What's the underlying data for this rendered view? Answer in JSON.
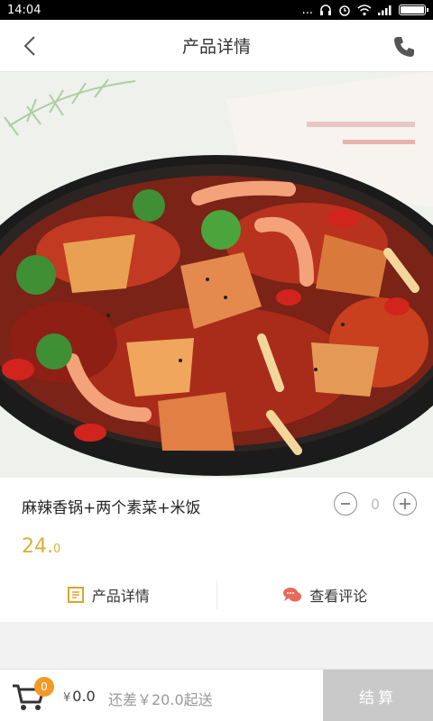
{
  "status_bar": {
    "time": "14:04",
    "dots": "..."
  },
  "header": {
    "title": "产品详情"
  },
  "product": {
    "name": "麻辣香锅+两个素菜+米饭",
    "price_int": "24.",
    "price_dec": "0",
    "quantity": "0"
  },
  "tabs": [
    {
      "label": "产品详情",
      "icon": "document-icon"
    },
    {
      "label": "查看评论",
      "icon": "comment-icon"
    }
  ],
  "cart": {
    "badge": "0",
    "currency": "¥",
    "total": "0.0",
    "min_order_text": "还差￥20.0起送",
    "checkout_label": "结算"
  },
  "colors": {
    "price": "#d8b13a",
    "badge": "#f29a25",
    "comment_icon": "#e86a5a",
    "document_icon": "#d8a62b",
    "checkout_bg": "#c9c9c9"
  }
}
